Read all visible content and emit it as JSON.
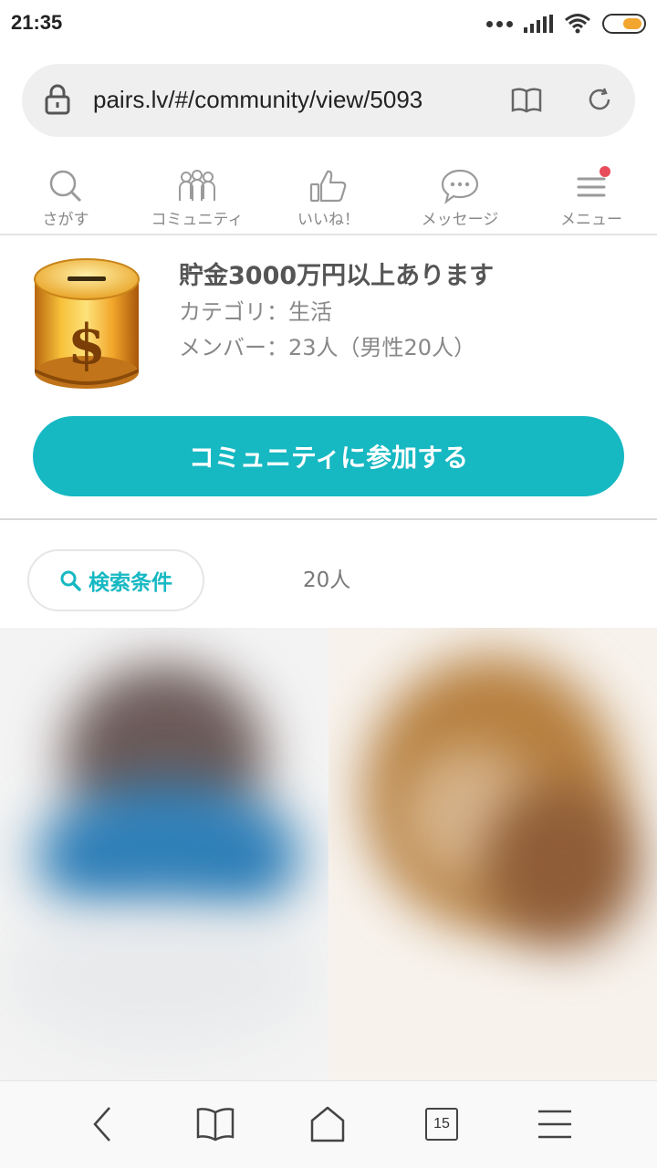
{
  "status_bar": {
    "time": "21:35"
  },
  "browser": {
    "url": "pairs.lv/#/community/view/5093"
  },
  "nav": {
    "items": [
      {
        "label": "さがす",
        "icon": "search-icon"
      },
      {
        "label": "コミュニティ",
        "icon": "community-icon"
      },
      {
        "label": "いいね！",
        "icon": "thumbs-up-icon"
      },
      {
        "label": "メッセージ",
        "icon": "message-icon"
      },
      {
        "label": "メニュー",
        "icon": "menu-icon",
        "badge": true
      }
    ]
  },
  "community": {
    "title": "貯金3000万円以上あります",
    "category": "カテゴリ：生活",
    "members": "メンバー：23人（男性20人）",
    "join_label": "コミュニティに参加する"
  },
  "search": {
    "button_label": "検索条件",
    "result_count": "20人"
  },
  "toolbar": {
    "tab_count": "15"
  },
  "colors": {
    "accent": "#16b8c2",
    "badge": "#e94c5a",
    "battery": "#f2a630"
  }
}
